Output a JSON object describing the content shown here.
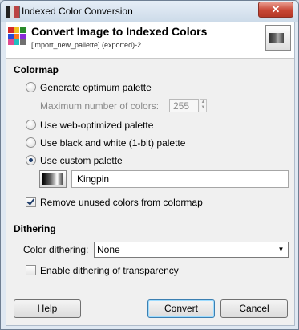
{
  "window": {
    "title": "Indexed Color Conversion",
    "close_glyph": "✕"
  },
  "header": {
    "title": "Convert Image to Indexed Colors",
    "subtitle": "[import_new_pallette] (exported)-2",
    "icon": "palette-grid-icon",
    "thumbnail": "image-thumbnail"
  },
  "colormap": {
    "heading": "Colormap",
    "options": [
      {
        "label": "Generate optimum palette",
        "selected": false
      },
      {
        "label": "Use web-optimized palette",
        "selected": false
      },
      {
        "label": "Use black and white (1-bit) palette",
        "selected": false
      },
      {
        "label": "Use custom palette",
        "selected": true
      }
    ],
    "max_colors_label": "Maximum number of colors:",
    "max_colors_value": "255",
    "custom_palette_name": "Kingpin",
    "remove_unused_label": "Remove unused colors from colormap",
    "remove_unused_checked": true
  },
  "dithering": {
    "heading": "Dithering",
    "color_dithering_label": "Color dithering:",
    "color_dithering_value": "None",
    "transparency_label": "Enable dithering of transparency",
    "transparency_checked": false
  },
  "buttons": {
    "help": "Help",
    "convert": "Convert",
    "cancel": "Cancel"
  },
  "colors": {
    "accent": "#1f3d6b",
    "window_bg": "#dfe8f2",
    "close_red": "#c74634"
  }
}
